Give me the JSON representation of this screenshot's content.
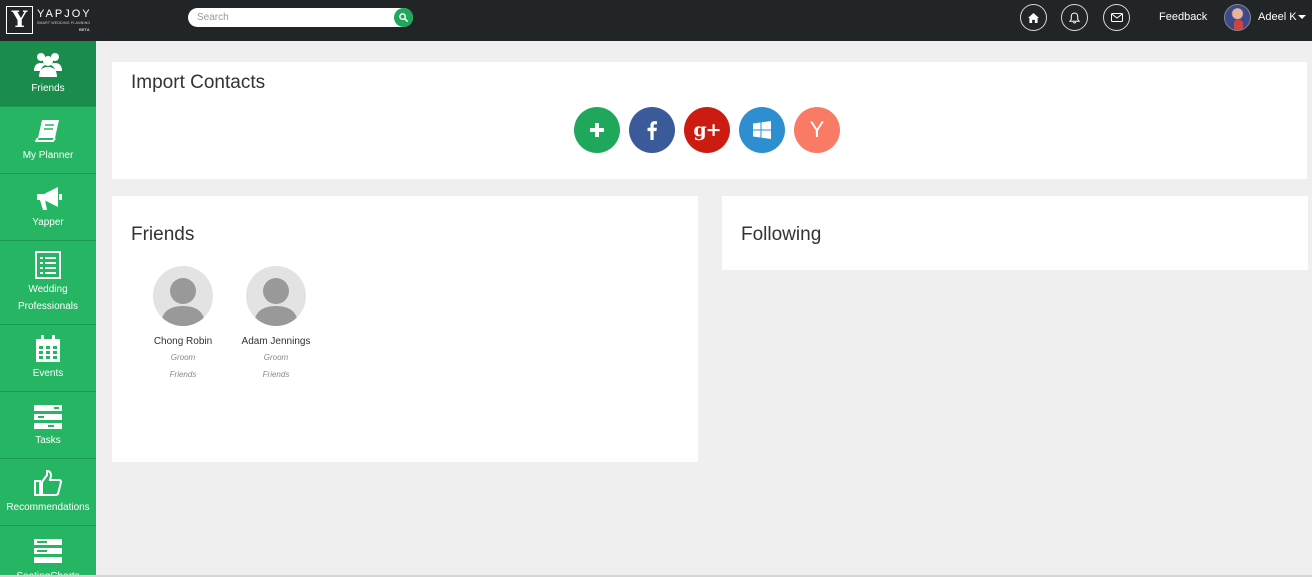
{
  "brand": {
    "name": "YAPJOY",
    "logo_letter": "Y",
    "tagline": "SMART WEDDING PLANNING",
    "badge": "BETA"
  },
  "search": {
    "placeholder": "Search"
  },
  "header": {
    "feedback": "Feedback",
    "user": "Adeel K"
  },
  "colors": {
    "brand_green": "#25b563",
    "facebook": "#3b5998",
    "google": "#cc1c12",
    "windows": "#2d8fd0",
    "yapjoy": "#f97b65"
  },
  "sidebar": {
    "items": [
      {
        "label": "Friends",
        "icon": "friends-icon",
        "active": true
      },
      {
        "label": "My Planner",
        "icon": "book-icon"
      },
      {
        "label": "Yapper",
        "icon": "megaphone-icon"
      },
      {
        "label": "Wedding Professionals",
        "icon": "list-icon"
      },
      {
        "label": "Events",
        "icon": "calendar-icon"
      },
      {
        "label": "Tasks",
        "icon": "tasks-icon"
      },
      {
        "label": "Recommendations",
        "icon": "thumbs-up-icon"
      },
      {
        "label": "SeatingCharts",
        "icon": "seating-icon"
      }
    ]
  },
  "import": {
    "title": "Import Contacts",
    "buttons": [
      {
        "name": "add",
        "icon": "plus-icon",
        "glyph": "+"
      },
      {
        "name": "facebook",
        "icon": "facebook-icon",
        "glyph": "f"
      },
      {
        "name": "google-plus",
        "icon": "google-plus-icon",
        "glyph": "g+"
      },
      {
        "name": "windows",
        "icon": "windows-icon",
        "glyph": ""
      },
      {
        "name": "yapjoy",
        "icon": "yapjoy-icon",
        "glyph": "Y"
      }
    ]
  },
  "friends": {
    "title": "Friends",
    "list": [
      {
        "name": "Chong Robin",
        "role": "Groom",
        "group": "Friends"
      },
      {
        "name": "Adam Jennings",
        "role": "Groom",
        "group": "Friends"
      }
    ]
  },
  "following": {
    "title": "Following"
  }
}
